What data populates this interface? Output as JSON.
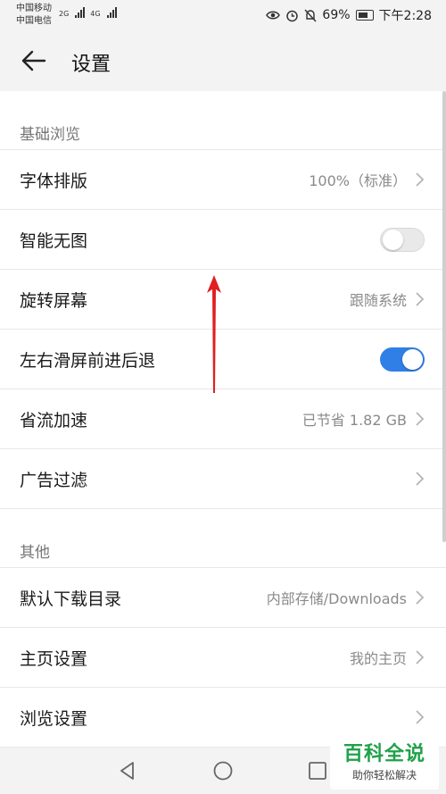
{
  "status_bar": {
    "carrier_1": "中国移动",
    "carrier_2": "中国电信",
    "network_1": "2G",
    "network_2": "4G",
    "battery": "69%",
    "time": "下午2:28",
    "icons": [
      "eye-icon",
      "alarm-icon",
      "mute-icon",
      "battery-icon"
    ]
  },
  "header": {
    "back_icon": "arrow-left-icon",
    "title": "设置"
  },
  "sections": {
    "basic": {
      "title": "基础浏览",
      "items": [
        {
          "label": "字体排版",
          "value": "100%（标准）"
        },
        {
          "label": "智能无图",
          "toggle": "off"
        },
        {
          "label": "旋转屏幕",
          "value": "跟随系统"
        },
        {
          "label": "左右滑屏前进后退",
          "toggle": "on"
        },
        {
          "label": "省流加速",
          "value": "已节省 1.82 GB"
        },
        {
          "label": "广告过滤"
        }
      ]
    },
    "other": {
      "title": "其他",
      "items": [
        {
          "label": "默认下载目录",
          "value": "内部存储/Downloads"
        },
        {
          "label": "主页设置",
          "value": "我的主页"
        },
        {
          "label": "浏览设置"
        }
      ]
    }
  },
  "colors": {
    "toggle_on": "#2f7fe6",
    "annotation_arrow": "#e02020",
    "watermark_green": "#20a14a"
  },
  "navigation_bar": {
    "icons": [
      "nav-back-icon",
      "nav-home-icon",
      "nav-recent-icon"
    ]
  },
  "watermark": {
    "logo": "百科全说",
    "tagline": "助你轻松解决"
  }
}
